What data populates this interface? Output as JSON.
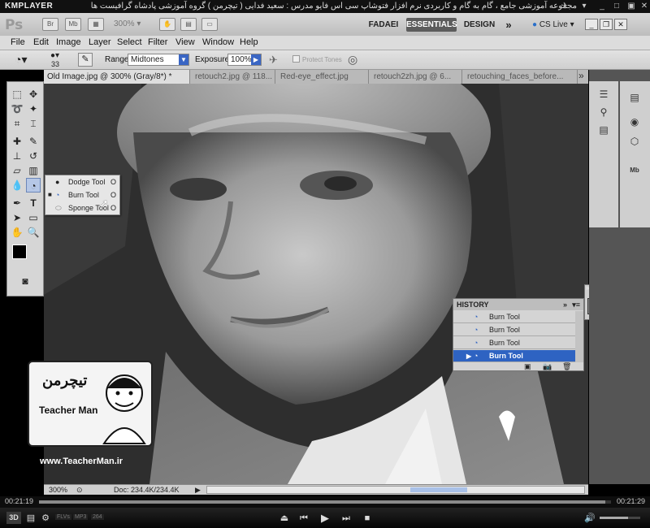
{
  "player": {
    "logo": "KMPLAYER",
    "caption": "مجموعه آموزشی جامع ، گام به گام و کاربردی نرم افزار فتوشاپ سی اس فایو مدرس : سعید فدایی ( تیچرمن ) گروه آموزشی پادشاه گرافیست ها",
    "time_elapsed": "00:21:19",
    "time_total": "00:21:29",
    "progress": 0.99,
    "volume": 0.7,
    "badge_3d": "3D",
    "format_labels": [
      "FLVs",
      "MP3",
      "264"
    ]
  },
  "app": {
    "logo": "Ps",
    "br": "Br",
    "mb": "Mb",
    "zoom": "300%",
    "workspaces": [
      "FADAEI",
      "ESSENTIALS",
      "DESIGN"
    ],
    "more": "»",
    "cs_live": "CS Live"
  },
  "menu": [
    "File",
    "Edit",
    "Image",
    "Layer",
    "Select",
    "Filter",
    "View",
    "Window",
    "Help"
  ],
  "options": {
    "brush_size": "33",
    "range_label": "Range:",
    "range_value": "Midtones",
    "exposure_label": "Exposure:",
    "exposure_value": "100%",
    "protect_tones": "Protect Tones"
  },
  "tabs": [
    "Old Image.jpg @ 300% (Gray/8*) *",
    "retouch2.jpg @ 118...",
    "Red-eye_effect.jpg",
    "retouch2zh.jpg @ 6...",
    "retouching_faces_before..."
  ],
  "flyout": {
    "items": [
      {
        "label": "Dodge Tool",
        "key": "O"
      },
      {
        "label": "Burn Tool",
        "key": "O"
      },
      {
        "label": "Sponge Tool",
        "key": "O"
      }
    ]
  },
  "history": {
    "title": "HISTORY",
    "rows": [
      "Burn Tool",
      "Burn Tool",
      "Burn Tool",
      "Burn Tool"
    ]
  },
  "status": {
    "zoom": "300%",
    "doc": "Doc: 234.4K/234.4K"
  },
  "watermark": {
    "brand_fa": "تیچرمن",
    "brand_en": "Teacher Man",
    "url": "www.TeacherMan.ir"
  },
  "colors": {
    "accent": "#2e63c2",
    "active_workspace": "#5c5c5c"
  }
}
